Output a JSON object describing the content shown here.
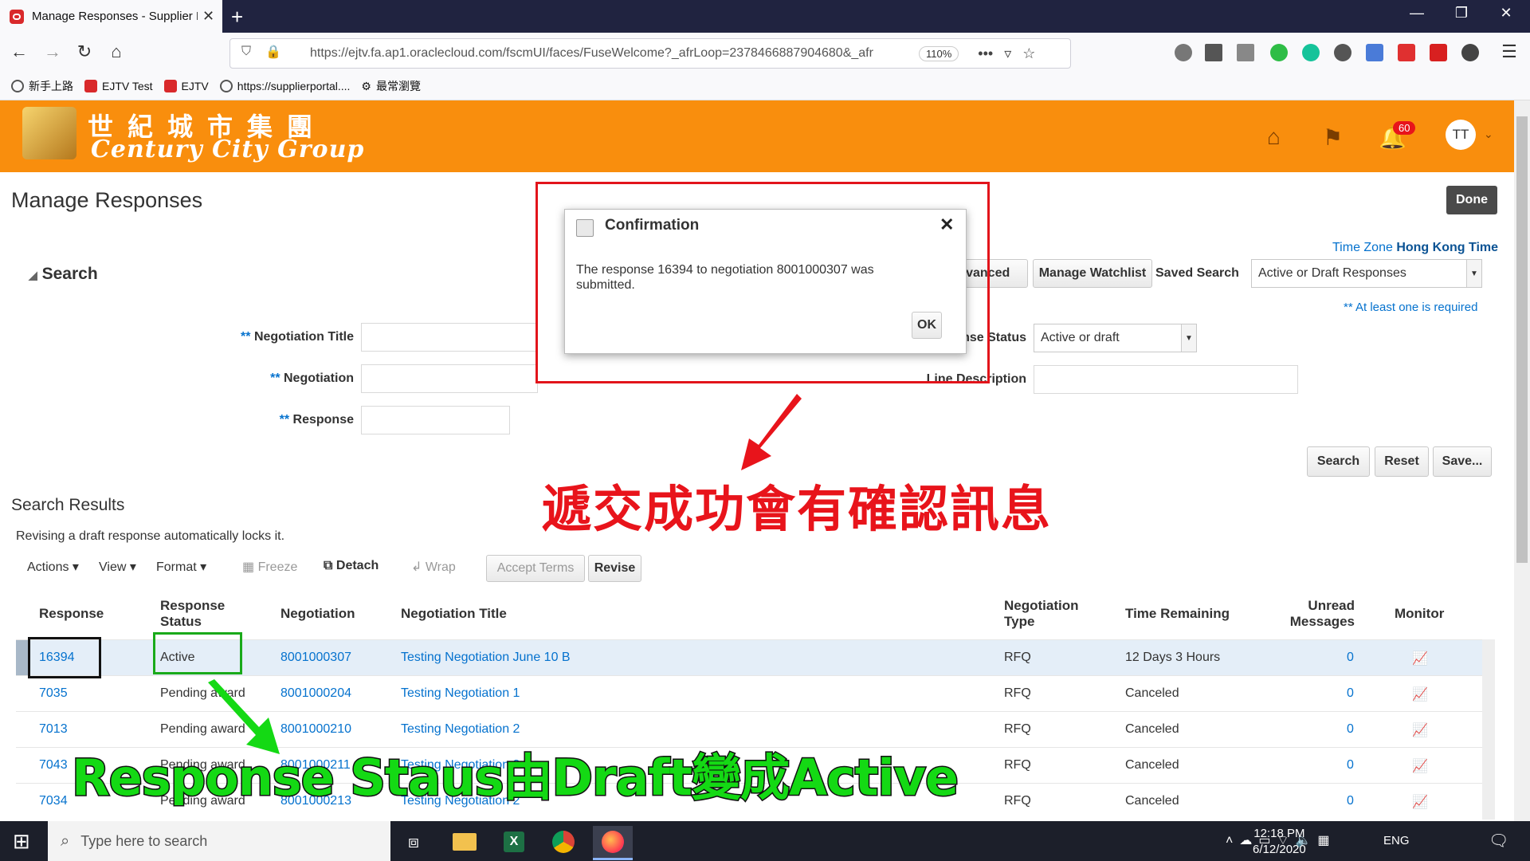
{
  "browser": {
    "tab_title": "Manage Responses - Supplier P",
    "url": "https://ejtv.fa.ap1.oraclecloud.com/fscmUI/faces/FuseWelcome?_afrLoop=2378466887904680&_afr",
    "zoom": "110%",
    "bookmarks": [
      "新手上路",
      "EJTV Test",
      "EJTV",
      "https://supplierportal....",
      "最常瀏覽"
    ]
  },
  "header": {
    "logo_cn": "世紀城市集團",
    "logo_en": "Century City Group",
    "notification_count": "60",
    "avatar": "TT"
  },
  "page": {
    "title": "Manage Responses",
    "done": "Done",
    "time_zone_label": "Time Zone",
    "time_zone_value": "Hong Kong Time",
    "search_heading": "Search",
    "advanced": "Advanced",
    "manage_watchlist": "Manage Watchlist",
    "saved_search_label": "Saved Search",
    "saved_search_value": "Active or Draft Responses",
    "required_note": "** At least one is required",
    "req_mark": "**",
    "fields": {
      "negotiation_title": "Negotiation Title",
      "negotiation": "Negotiation",
      "response": "Response",
      "response_status": "Response Status",
      "response_status_value": "Active or draft",
      "line_description": "Line Description"
    },
    "buttons": {
      "search": "Search",
      "reset": "Reset",
      "save": "Save..."
    }
  },
  "results": {
    "heading": "Search Results",
    "note": "Revising a draft response automatically locks it.",
    "toolbar": {
      "actions": "Actions",
      "view": "View",
      "format": "Format",
      "freeze": "Freeze",
      "detach": "Detach",
      "wrap": "Wrap",
      "accept_terms": "Accept Terms",
      "revise": "Revise"
    },
    "columns": [
      "Response",
      "Response Status",
      "Negotiation",
      "Negotiation Title",
      "Negotiation Type",
      "Time Remaining",
      "Unread Messages",
      "Monitor"
    ],
    "rows": [
      {
        "response": "16394",
        "status": "Active",
        "negotiation": "8001000307",
        "title": "Testing Negotiation June 10 B",
        "type": "RFQ",
        "time": "12 Days 3 Hours",
        "unread": "0"
      },
      {
        "response": "7035",
        "status": "Pending award",
        "negotiation": "8001000204",
        "title": "Testing Negotiation 1",
        "type": "RFQ",
        "time": "Canceled",
        "unread": "0"
      },
      {
        "response": "7013",
        "status": "Pending award",
        "negotiation": "8001000210",
        "title": "Testing Negotiation 2",
        "type": "RFQ",
        "time": "Canceled",
        "unread": "0"
      },
      {
        "response": "7043",
        "status": "Pending award",
        "negotiation": "8001000211",
        "title": "Testing Negotiation 3",
        "type": "RFQ",
        "time": "Canceled",
        "unread": "0"
      },
      {
        "response": "7034",
        "status": "Pending award",
        "negotiation": "8001000213",
        "title": "Testing Negotiation 2",
        "type": "RFQ",
        "time": "Canceled",
        "unread": "0"
      }
    ]
  },
  "dialog": {
    "title": "Confirmation",
    "message": "The response 16394 to negotiation 8001000307 was submitted.",
    "ok": "OK"
  },
  "annotations": {
    "red_text": "遞交成功會有確認訊息",
    "green_text": "Response Staus由Draft變成Active"
  },
  "taskbar": {
    "search_placeholder": "Type here to search",
    "lang": "ENG",
    "time": "12:18 PM",
    "date": "6/12/2020"
  },
  "colors": {
    "brand_orange": "#f98e0d",
    "link": "#0572ce",
    "annotation_red": "#e8141b",
    "annotation_green": "#14d914"
  }
}
